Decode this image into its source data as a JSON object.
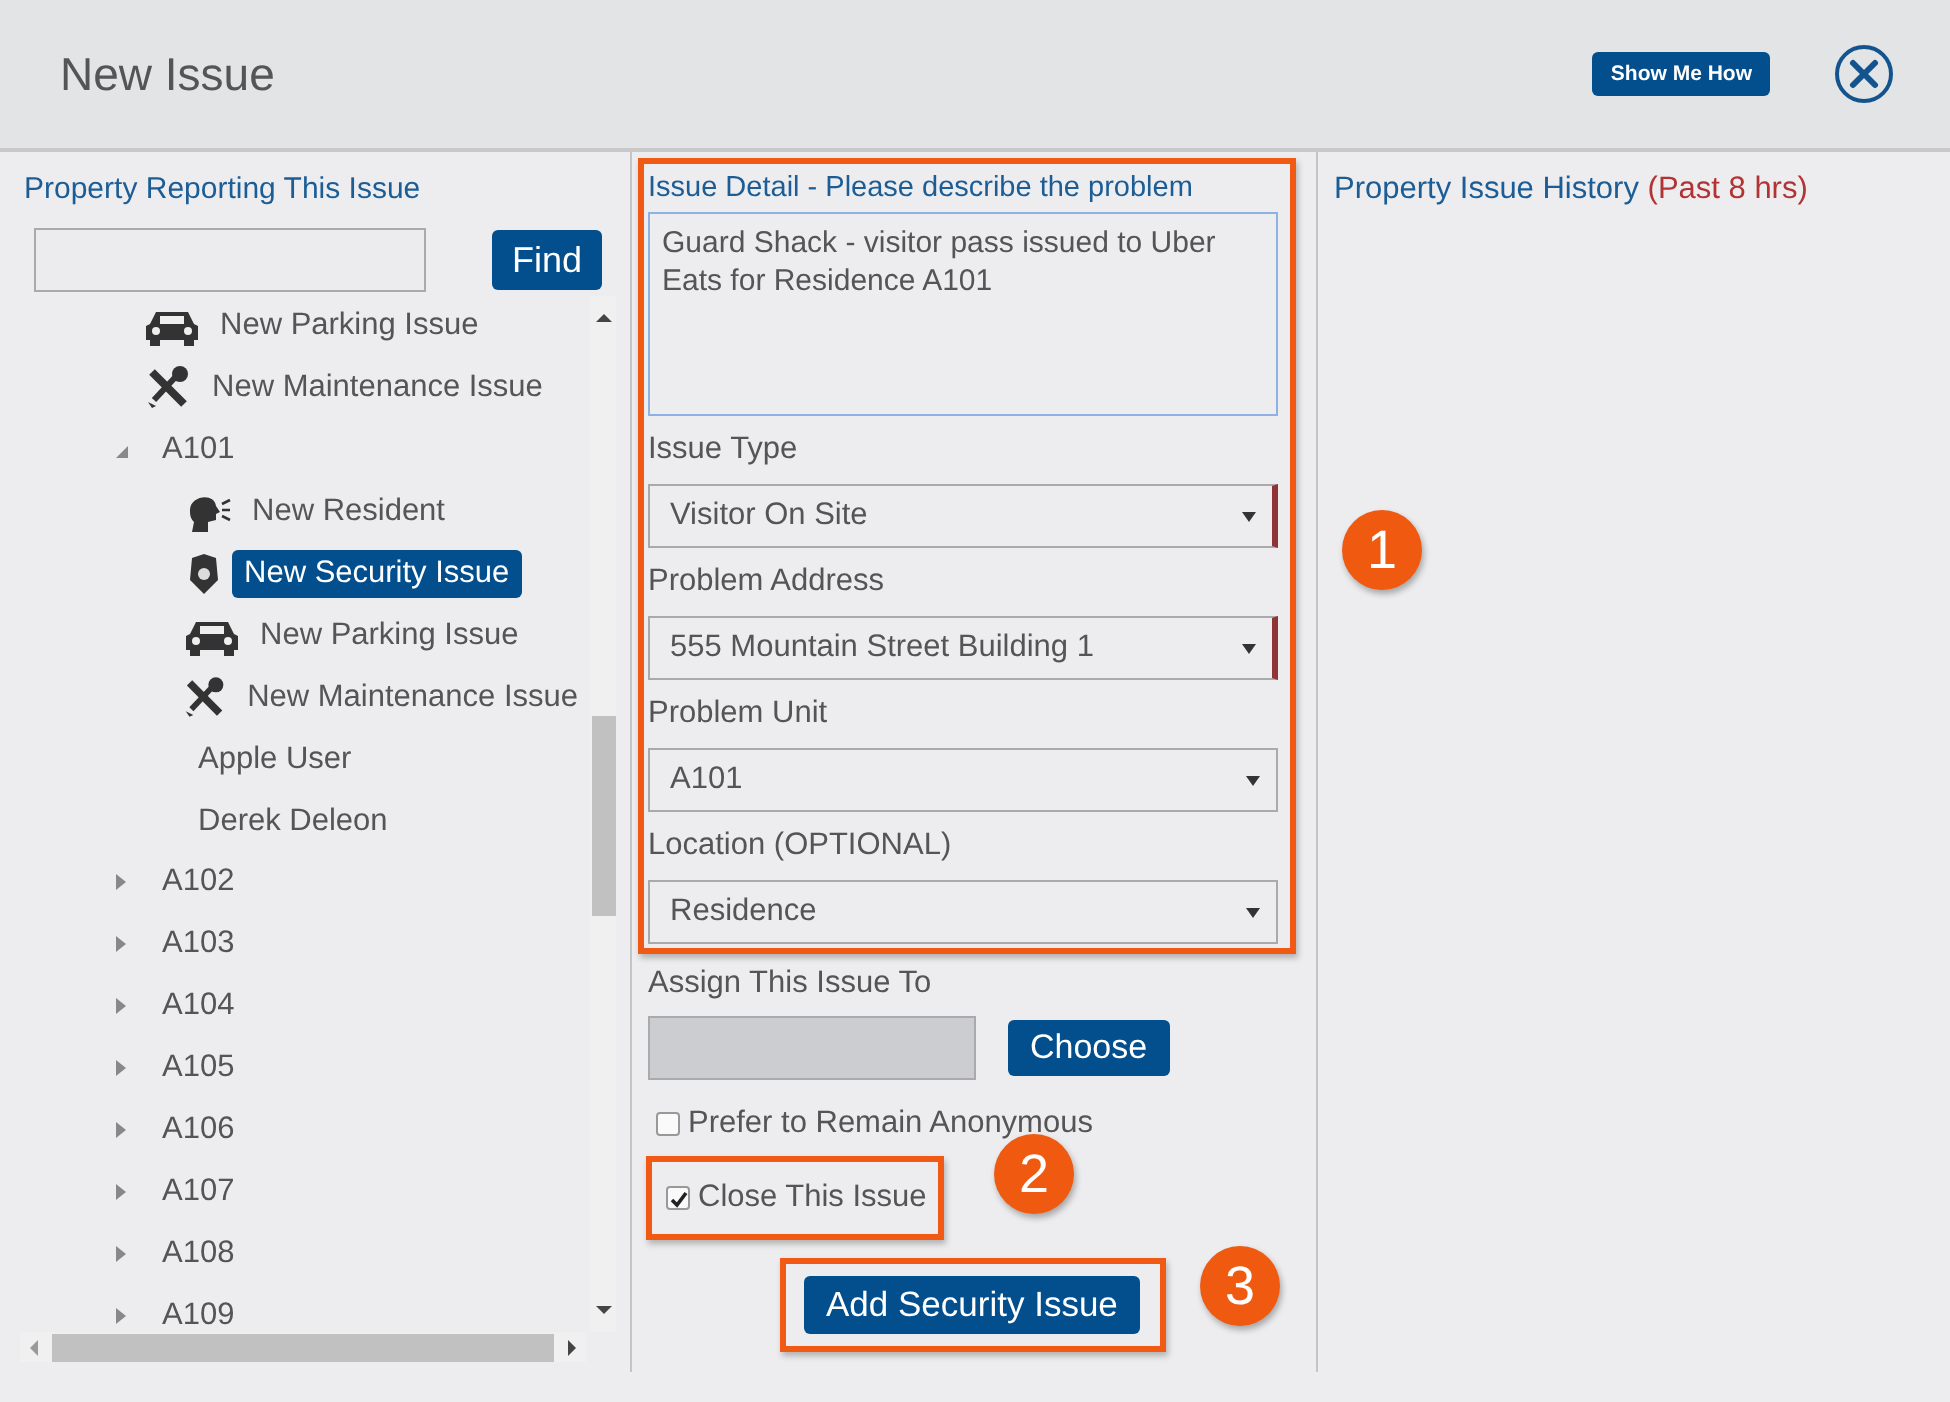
{
  "window": {
    "title": "New Issue",
    "help_button": "Show Me How"
  },
  "property_panel": {
    "heading": "Property Reporting This Issue",
    "find_button": "Find",
    "tree": [
      {
        "label": "New Parking Issue",
        "kind": "parking",
        "selected": false
      },
      {
        "label": "New Maintenance Issue",
        "kind": "maintenance",
        "selected": false
      },
      {
        "label": "A101",
        "kind": "unit",
        "expanded": true,
        "selected": false,
        "children": [
          {
            "label": "New Resident",
            "kind": "resident",
            "selected": false
          },
          {
            "label": "New Security Issue",
            "kind": "security",
            "selected": true
          },
          {
            "label": "New Parking Issue",
            "kind": "parking",
            "selected": false
          },
          {
            "label": "New Maintenance Issue",
            "kind": "maintenance",
            "selected": false
          },
          {
            "label": "Apple User",
            "kind": "person",
            "selected": false
          },
          {
            "label": "Derek Deleon",
            "kind": "person",
            "selected": false
          }
        ]
      },
      {
        "label": "A102",
        "kind": "unit",
        "expanded": false,
        "selected": false
      },
      {
        "label": "A103",
        "kind": "unit",
        "expanded": false,
        "selected": false
      },
      {
        "label": "A104",
        "kind": "unit",
        "expanded": false,
        "selected": false
      },
      {
        "label": "A105",
        "kind": "unit",
        "expanded": false,
        "selected": false
      },
      {
        "label": "A106",
        "kind": "unit",
        "expanded": false,
        "selected": false
      },
      {
        "label": "A107",
        "kind": "unit",
        "expanded": false,
        "selected": false
      },
      {
        "label": "A108",
        "kind": "unit",
        "expanded": false,
        "selected": false
      },
      {
        "label": "A109",
        "kind": "unit",
        "expanded": false,
        "selected": false
      }
    ]
  },
  "issue_form": {
    "detail_label": "Issue Detail - Please describe the problem",
    "detail_value": "Guard Shack - visitor pass issued to Uber Eats for Residence A101",
    "selects": [
      {
        "label": "Issue Type",
        "value": "Visitor On Site",
        "required": true
      },
      {
        "label": "Problem Address",
        "value": "555 Mountain Street Building 1",
        "required": true
      },
      {
        "label": "Problem Unit",
        "value": "A101",
        "required": false
      },
      {
        "label": "Location (OPTIONAL)",
        "value": "Residence",
        "required": false
      }
    ],
    "assign_label": "Assign This Issue To",
    "choose_button": "Choose",
    "checkboxes": [
      {
        "label": "Prefer to Remain Anonymous",
        "checked": false
      },
      {
        "label": "Close This Issue",
        "checked": true
      }
    ],
    "submit_button": "Add Security Issue"
  },
  "history_panel": {
    "heading": "Property Issue History",
    "period": "(Past 8 hrs)"
  },
  "callouts": [
    "1",
    "2",
    "3"
  ]
}
